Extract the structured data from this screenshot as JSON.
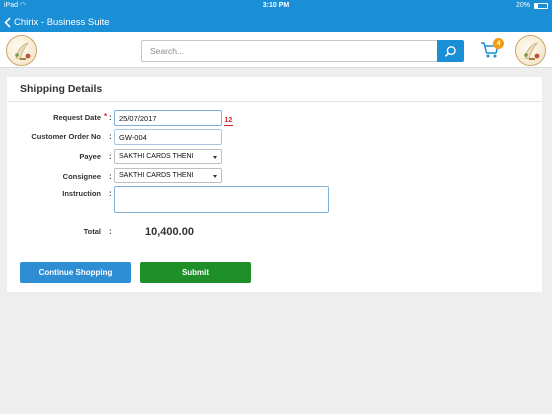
{
  "status_bar": {
    "carrier": "iPad",
    "time": "3:10 PM",
    "battery": "20%"
  },
  "nav": {
    "title": "Chirix - Business Suite"
  },
  "header": {
    "search_placeholder": "Search...",
    "cart_count": "4"
  },
  "form": {
    "title": "Shipping Details",
    "request_date": {
      "label": "Request Date",
      "required_mark": "*",
      "value": "25/07/2017"
    },
    "calendar_glyph": "12",
    "customer_order_no": {
      "label": "Customer Order No",
      "value": "GW-004"
    },
    "payee": {
      "label": "Payee",
      "value": "SAKTHI CARDS THENI"
    },
    "consignee": {
      "label": "Consignee",
      "value": "SAKTHI CARDS THENI"
    },
    "instruction": {
      "label": "Instruction",
      "value": ""
    },
    "total": {
      "label": "Total",
      "value": "10,400.00"
    },
    "colon": ":"
  },
  "buttons": {
    "continue_shopping": "Continue Shopping",
    "submit": "Submit"
  },
  "colors": {
    "primary": "#1a8fd6",
    "submit": "#1f8f2a",
    "badge": "#f39c12"
  }
}
